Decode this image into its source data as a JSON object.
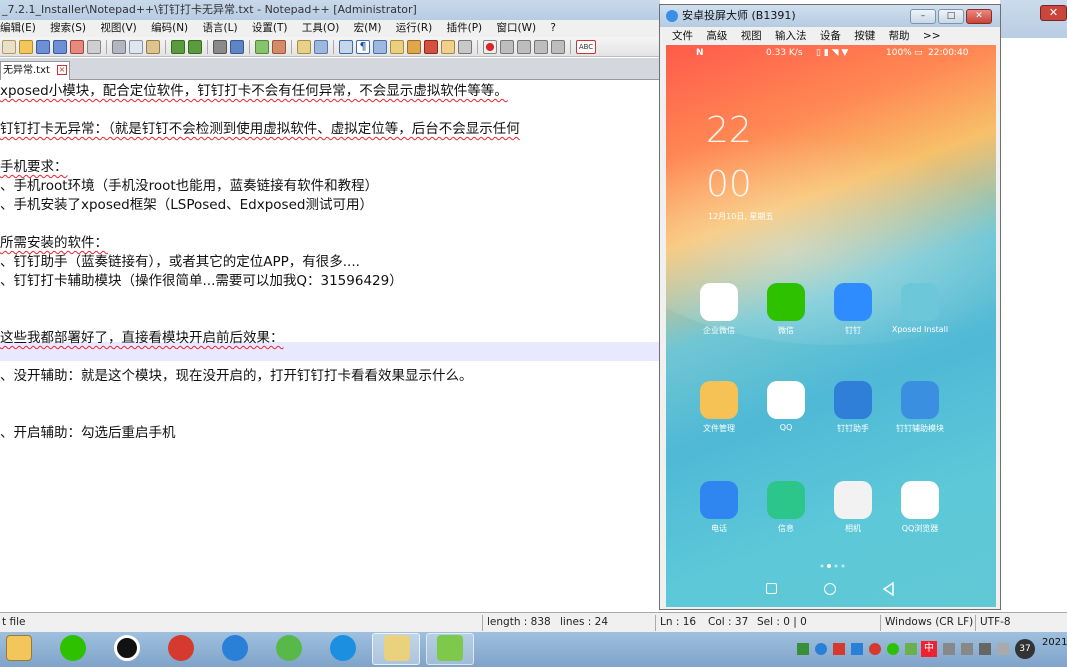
{
  "npp": {
    "title": "_7.2.1_Installer\\Notepad++\\钉钉打卡无异常.txt - Notepad++ [Administrator]",
    "menu": [
      "编辑(E)",
      "搜索(S)",
      "视图(V)",
      "编码(N)",
      "语言(L)",
      "设置(T)",
      "工具(O)",
      "宏(M)",
      "运行(R)",
      "插件(P)",
      "窗口(W)",
      "?"
    ],
    "tab": "无异常.txt",
    "lines": [
      "xposed小模块，配合定位软件，钉钉打卡不会有任何异常，不会显示虚拟软件等等。",
      "",
      "钉钉打卡无异常：（就是钉钉不会检测到使用虚拟软件、虚拟定位等，后台不会显示任何",
      "",
      "手机要求：",
      "、手机root环境（手机没root也能用，蓝奏链接有软件和教程）",
      "、手机安装了xposed框架（LSPosed、Edxposed测试可用）",
      "",
      "所需安装的软件：",
      "、钉钉助手（蓝奏链接有），或者其它的定位APP，有很多....",
      "、钉钉打卡辅助模块（操作很简单...需要可以加我Q：31596429）",
      "",
      "",
      "这些我都部署好了，直接看模块开启前后效果：",
      "",
      "、没开辅助：就是这个模块，现在没开启的，打开钉钉打卡看看效果显示什么。",
      "",
      "",
      "、开启辅助：勾选后重启手机"
    ],
    "status": {
      "filetype": "t file",
      "length": "length : 838",
      "lines": "lines : 24",
      "ln": "Ln : 16",
      "col": "Col : 37",
      "sel": "Sel : 0 | 0",
      "eol": "Windows (CR LF)",
      "enc": "UTF-8"
    }
  },
  "phone_window": {
    "title": "安卓投屏大师 (B1391)",
    "menu": [
      "文件",
      "高级",
      "视图",
      "输入法",
      "设备",
      "按键",
      "帮助",
      ">>"
    ],
    "status_speed": "0.33 K/s",
    "status_battery": "100%",
    "status_time": "22:00:40",
    "clock_hour": "22",
    "clock_min": "00",
    "date": "12月10日, 星期五",
    "apps": [
      {
        "label": "企业微信",
        "icon": "wecom-icon",
        "color": "#ffffff"
      },
      {
        "label": "微信",
        "icon": "wechat-icon",
        "color": "#2dc100"
      },
      {
        "label": "钉钉",
        "icon": "dingtalk-icon",
        "color": "#2f8cff"
      },
      {
        "label": "Xposed Install",
        "icon": "xposed-icon",
        "color": "#6cc8d8"
      },
      {
        "label": "文件管理",
        "icon": "folder-icon",
        "color": "#f6c155"
      },
      {
        "label": "QQ",
        "icon": "qq-icon",
        "color": "#ffffff"
      },
      {
        "label": "钉钉助手",
        "icon": "tools-icon",
        "color": "#2f7fd8"
      },
      {
        "label": "钉钉辅助模块",
        "icon": "module-icon",
        "color": "#3a8fe0"
      },
      {
        "label": "电话",
        "icon": "phone-icon",
        "color": "#2f86f0"
      },
      {
        "label": "信息",
        "icon": "message-icon",
        "color": "#2cc58a"
      },
      {
        "label": "相机",
        "icon": "camera-icon",
        "color": "#f2f2f2"
      },
      {
        "label": "QQ浏览器",
        "icon": "browser-icon",
        "color": "#ffffff"
      }
    ]
  },
  "taskbar": {
    "tray_badge": "37",
    "clock": "2021"
  }
}
